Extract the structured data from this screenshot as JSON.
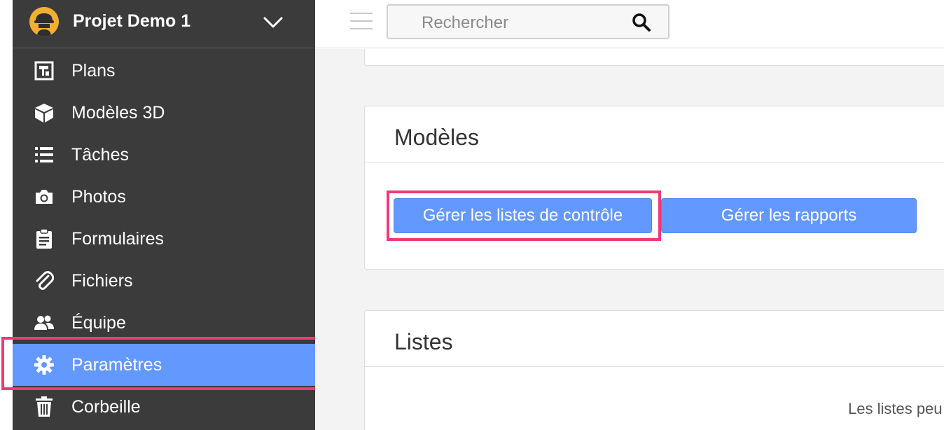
{
  "project": {
    "name": "Projet Demo 1"
  },
  "sidebar": {
    "items": [
      {
        "label": "Plans",
        "icon": "plans-icon",
        "active": false
      },
      {
        "label": "Modèles 3D",
        "icon": "cube-icon",
        "active": false
      },
      {
        "label": "Tâches",
        "icon": "task-list-icon",
        "active": false
      },
      {
        "label": "Photos",
        "icon": "camera-icon",
        "active": false
      },
      {
        "label": "Formulaires",
        "icon": "clipboard-icon",
        "active": false
      },
      {
        "label": "Fichiers",
        "icon": "paperclip-icon",
        "active": false
      },
      {
        "label": "Équipe",
        "icon": "team-icon",
        "active": false
      },
      {
        "label": "Paramètres",
        "icon": "gear-icon",
        "active": true
      },
      {
        "label": "Corbeille",
        "icon": "trash-icon",
        "active": false
      }
    ]
  },
  "search": {
    "placeholder": "Rechercher"
  },
  "models_card": {
    "title": "Modèles",
    "buttons": {
      "checklists": "Gérer les listes de contrôle",
      "reports": "Gérer les rapports"
    }
  },
  "lists_card": {
    "title": "Listes",
    "note": "Les listes peu"
  },
  "colors": {
    "sidebar_bg": "#3b3b3b",
    "accent": "#6398ff",
    "highlight": "#ee3a78",
    "logo": "#f0b132"
  }
}
